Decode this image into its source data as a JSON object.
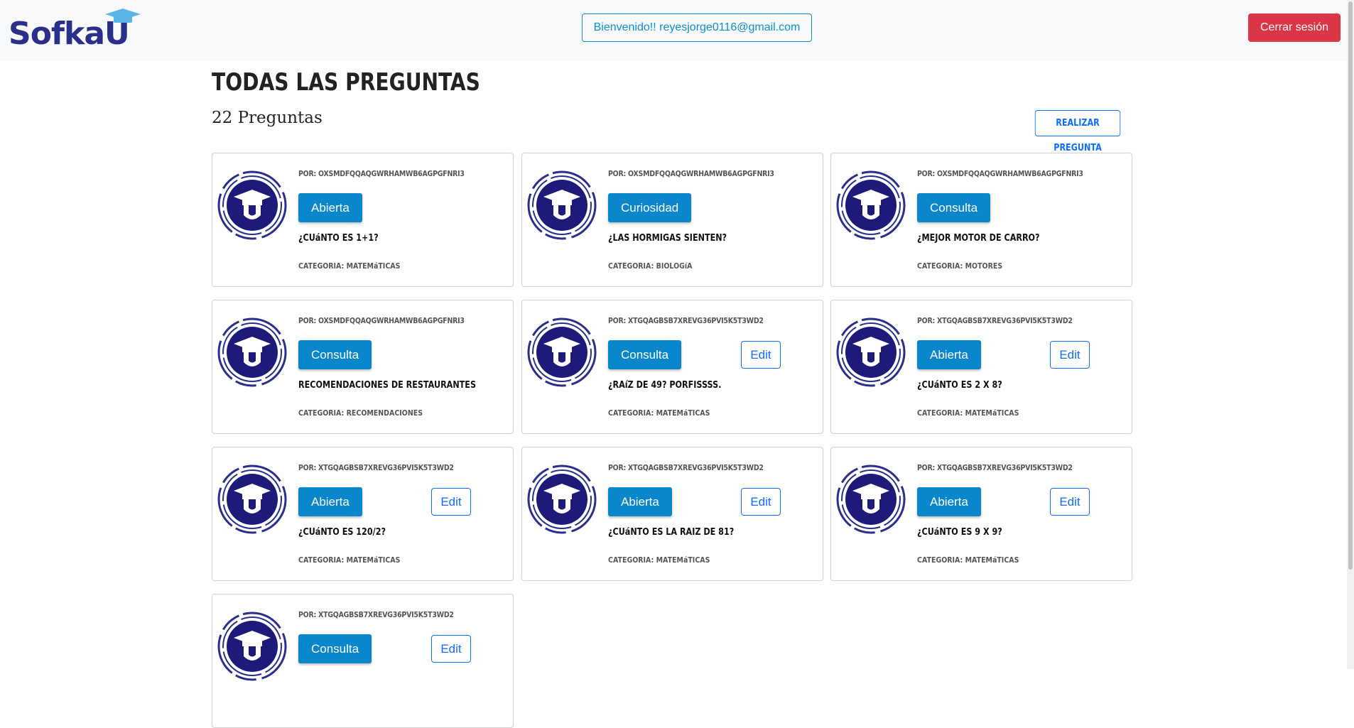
{
  "header": {
    "logo_text": "SofkaU",
    "welcome": "Bienvenido!! reyesjorge0116@gmail.com",
    "logout_label": "Cerrar sesión"
  },
  "main": {
    "title": "TODAS LAS PREGUNTAS",
    "count": "22 Preguntas",
    "ask_label": "REALIZAR PREGUNTA",
    "cards": [
      {
        "author": "POR: OXSMDFQQAQGWRHAMWB6AGPGFNRI3",
        "tag": "Abierta",
        "question": "¿CUáNTO ES 1+1?",
        "category": "CATEGORIA: MATEMáTICAS",
        "edit": ""
      },
      {
        "author": "POR: OXSMDFQQAQGWRHAMWB6AGPGFNRI3",
        "tag": "Curiosidad",
        "question": "¿LAS HORMIGAS SIENTEN?",
        "category": "CATEGORIA: BIOLOGíA",
        "edit": ""
      },
      {
        "author": "POR: OXSMDFQQAQGWRHAMWB6AGPGFNRI3",
        "tag": "Consulta",
        "question": "¿MEJOR MOTOR DE CARRO?",
        "category": "CATEGORIA: MOTORES",
        "edit": ""
      },
      {
        "author": "POR: OXSMDFQQAQGWRHAMWB6AGPGFNRI3",
        "tag": "Consulta",
        "question": "RECOMENDACIONES DE RESTAURANTES",
        "category": "CATEGORIA: RECOMENDACIONES",
        "edit": ""
      },
      {
        "author": "POR: XTGQAGBSB7XREVG36PVI5K5T3WD2",
        "tag": "Consulta",
        "question": "¿RAíZ DE 49? PORFISSSS.",
        "category": "CATEGORIA: MATEMáTICAS",
        "edit": "Edit"
      },
      {
        "author": "POR: XTGQAGBSB7XREVG36PVI5K5T3WD2",
        "tag": "Abierta",
        "question": "¿CUáNTO ES 2 X 8?",
        "category": "CATEGORIA: MATEMáTICAS",
        "edit": "Edit"
      },
      {
        "author": "POR: XTGQAGBSB7XREVG36PVI5K5T3WD2",
        "tag": "Abierta",
        "question": "¿CUáNTO ES 120/2?",
        "category": "CATEGORIA: MATEMáTICAS",
        "edit": "Edit"
      },
      {
        "author": "POR: XTGQAGBSB7XREVG36PVI5K5T3WD2",
        "tag": "Abierta",
        "question": "¿CUáNTO ES LA RAIZ DE 81?",
        "category": "CATEGORIA: MATEMáTICAS",
        "edit": "Edit"
      },
      {
        "author": "POR: XTGQAGBSB7XREVG36PVI5K5T3WD2",
        "tag": "Abierta",
        "question": "¿CUáNTO ES 9 X 9?",
        "category": "CATEGORIA: MATEMáTICAS",
        "edit": "Edit"
      },
      {
        "author": "POR: XTGQAGBSB7XREVG36PVI5K5T3WD2",
        "tag": "Consulta",
        "question": "",
        "category": "",
        "edit": "Edit"
      }
    ]
  },
  "colors": {
    "brand_navy": "#2a2f8c",
    "tag_blue": "#0a86cc",
    "logout_red": "#dc3545",
    "outline_blue": "#0d6efd"
  }
}
